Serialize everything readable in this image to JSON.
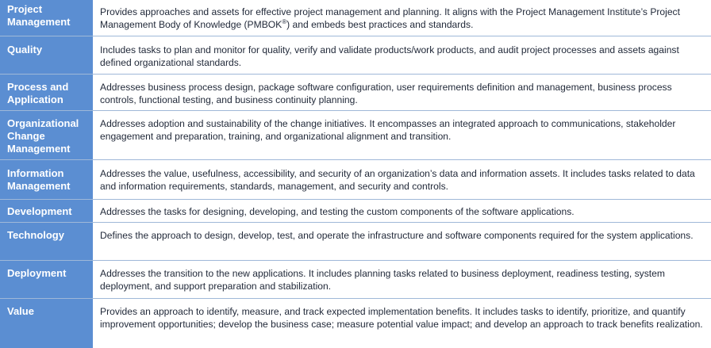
{
  "rows": [
    {
      "label": "Project Management",
      "text_a": "Provides approaches and assets for effective project management and planning.  It aligns with the Project Management Institute’s Project Management Body of Knowledge (PMBOK",
      "text_sup": "®",
      "text_b": ") and embeds best practices and standards."
    },
    {
      "label": "Quality",
      "text": "Includes tasks to plan and monitor for quality, verify and validate products/work products, and audit project processes and assets against defined organizational standards."
    },
    {
      "label": "Process and Application",
      "text": "Addresses business process design, package software configuration, user requirements definition and management, business process controls, functional testing, and business continuity planning."
    },
    {
      "label": "Organizational Change Management",
      "text": "Addresses adoption and sustainability of the change initiatives. It encompasses an integrated approach to communications, stakeholder engagement and preparation, training, and organizational alignment and transition."
    },
    {
      "label": "Information Management",
      "text": "Addresses the value, usefulness, accessibility, and security of an organization’s data and information assets. It includes tasks related to data and information requirements, standards, management, and security and controls."
    },
    {
      "label": "Development",
      "text": "Addresses the tasks for designing, developing, and testing the custom components of the software applications."
    },
    {
      "label": "Technology",
      "text": "Defines the approach to design, develop, test, and operate the infrastructure and software components required for the system applications."
    },
    {
      "label": "Deployment",
      "text": "Addresses the transition to the new applications. It includes planning tasks related to business deployment, readiness testing, system deployment, and support preparation and stabilization."
    },
    {
      "label": "Value",
      "text": "Provides an approach to identify, measure, and track expected implementation benefits. It includes tasks to identify, prioritize, and quantify improvement opportunities; develop the business case; measure potential value impact; and develop an approach to track benefits realization."
    }
  ]
}
